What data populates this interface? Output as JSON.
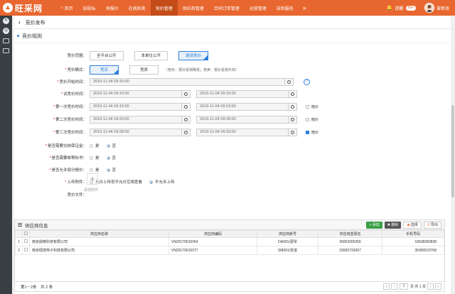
{
  "app": {
    "logo_text": "旺采网"
  },
  "nav": {
    "items": [
      "首页",
      "招投标",
      "询报价",
      "在线拍卖",
      "竞价管理",
      "供应商管理",
      "合同订单管理",
      "运营管理",
      "自助服务"
    ],
    "active_index": 4,
    "more": "»"
  },
  "user": {
    "reminder_label": "提醒",
    "reminder_count": "99+",
    "name": "曾新南"
  },
  "page": {
    "title": "竞价发布",
    "section_title": "竞价规则"
  },
  "form": {
    "scope": {
      "label": "竞价范围：",
      "options": [
        "全平台公开",
        "本单位公开",
        "邀请竞价"
      ],
      "selected": 2
    },
    "mode": {
      "label": "竞价模式：",
      "options": [
        "竞买",
        "竞卖"
      ],
      "selected": 0,
      "hint": "（竞买：报价逐渐降低；竞卖：报价逐渐升高）"
    },
    "start_time": {
      "label": "竞价开始时间：",
      "value": "2019-11-04 09:15:00"
    },
    "trial_time": {
      "label": "试竞价时间：",
      "from": "2019-11-04 09:10:00",
      "to": "2019-11-04 09:15:00"
    },
    "round1": {
      "label": "第一次竞价时间：",
      "from": "2019-11-04 09:15:00",
      "to": "2019-11-04 09:23:00",
      "check": "暗价",
      "checked": false
    },
    "round2": {
      "label": "第二次竞价时间：",
      "from": "2019-11-04 09:23:00",
      "to": "2019-11-04 09:28:00",
      "check": "暗价",
      "checked": false
    },
    "round3": {
      "label": "第三次竞价时间：",
      "from": "2019-11-04 09:28:00",
      "to": "2019-11-04 09:33:00",
      "check": "暗价",
      "checked": true
    },
    "deposit": {
      "label": "是否需要交纳保证金：",
      "yes": "是",
      "no": "否",
      "value": "no"
    },
    "mail_doc": {
      "label": "是否需要邮寄标书：",
      "yes": "是",
      "no": "否",
      "value": "no"
    },
    "partial": {
      "label": "是否允许部分报价：",
      "yes": "是",
      "no": "否",
      "value": "no"
    },
    "upload_attachment": {
      "label": "上传附件：",
      "opt1": "允许上传但不允许互相查看",
      "opt2": "不允许上传",
      "value": "opt2"
    },
    "files": {
      "label": "竞价文件：",
      "add_label": "添加附件"
    }
  },
  "suppliers": {
    "title": "供应商信息",
    "buttons": {
      "add": "+ 添加",
      "delete": "✖ 删除",
      "pick": "选择",
      "export": "导出"
    },
    "columns": [
      "供应商名称",
      "供应商编码",
      "供应商账号",
      "供应商登录名",
      "手机号码"
    ],
    "rows": [
      {
        "no": "1",
        "name": "南京鼎微科技有限公司",
        "code": "VN20170615054",
        "account": "DA001/邵琴",
        "login": "35652000256",
        "phone": "18538383838"
      },
      {
        "no": "2",
        "name": "南京硕茂电子科技有限公司",
        "code": "VN20170615077",
        "account": "SM001/曾进",
        "login": "33065733067",
        "phone": "35950523768"
      }
    ],
    "footer": {
      "summary": "第1－2条　共 2 条",
      "page": "1",
      "pages": "页 共 1 页"
    }
  }
}
